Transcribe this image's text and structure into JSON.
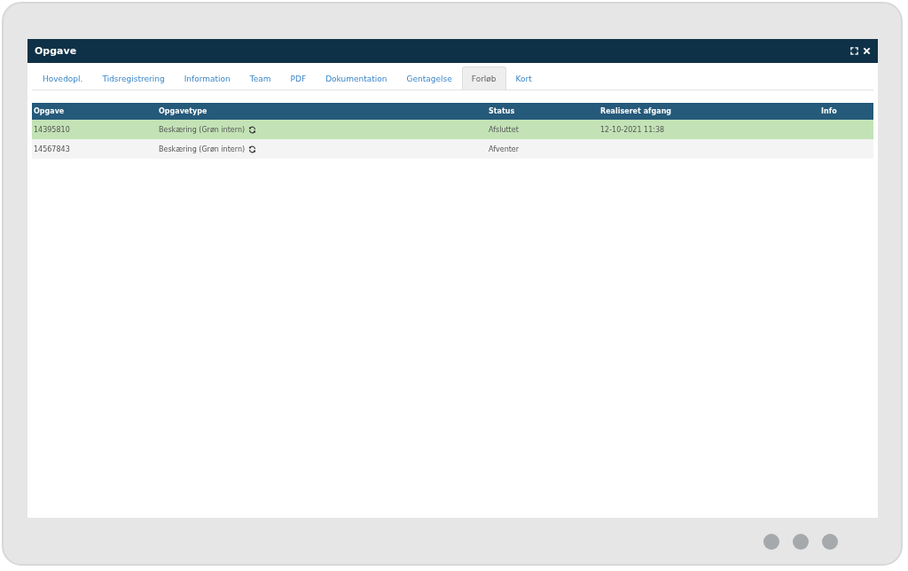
{
  "window": {
    "title": "Opgave"
  },
  "tabs": [
    {
      "label": "Hovedopl.",
      "selected": false
    },
    {
      "label": "Tidsregistrering",
      "selected": false
    },
    {
      "label": "Information",
      "selected": false
    },
    {
      "label": "Team",
      "selected": false
    },
    {
      "label": "PDF",
      "selected": false
    },
    {
      "label": "Dokumentation",
      "selected": false
    },
    {
      "label": "Gentagelse",
      "selected": false
    },
    {
      "label": "Forløb",
      "selected": true
    },
    {
      "label": "Kort",
      "selected": false
    }
  ],
  "table": {
    "columns": [
      "Opgave",
      "Opgavetype",
      "Status",
      "Realiseret afgang",
      "Info"
    ],
    "rows": [
      {
        "opgave": "14395810",
        "type": "Beskæring (Grøn intern)",
        "status": "Afsluttet",
        "realiseret": "12-10-2021 11:38",
        "highlighted": true
      },
      {
        "opgave": "14567843",
        "type": "Beskæring (Grøn intern)",
        "status": "Afventer",
        "highlighted": false
      }
    ]
  }
}
